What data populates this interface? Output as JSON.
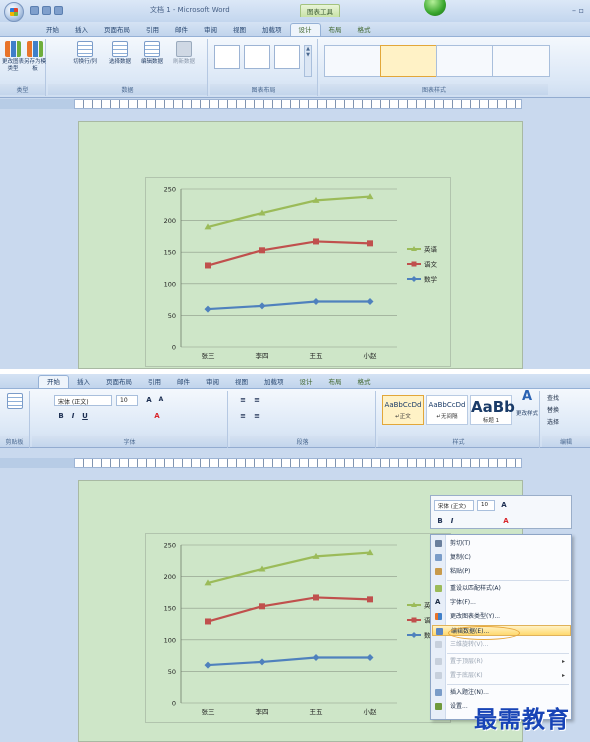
{
  "colors": {
    "english": "#9bbb59",
    "chinese": "#c0504d",
    "math": "#4f81bd",
    "page_bg": "#cee6c8",
    "menu_highlight": "#ffd96e",
    "watermark": "#1844b6"
  },
  "shot1": {
    "window_title": "文档 1 - Microsoft Word",
    "context_tools": "图表工具",
    "tabs": [
      "开始",
      "插入",
      "页面布局",
      "引用",
      "邮件",
      "审阅",
      "视图",
      "加载项",
      "设计",
      "布局",
      "格式"
    ],
    "active_tab": "设计",
    "ribbon": {
      "change_type": "更改图表类型",
      "save_template": "另存为模板",
      "switch_rowcol": "切换行/列",
      "select_data": "选择数据",
      "edit_data": "编辑数据",
      "refresh_data": "刷新数据",
      "group_type": "类型",
      "group_data": "数据",
      "group_layout": "图表布局",
      "group_styles": "图表样式"
    }
  },
  "shot2": {
    "tabs": [
      "开始",
      "插入",
      "页面布局",
      "引用",
      "邮件",
      "审阅",
      "视图",
      "加载项",
      "设计",
      "布局",
      "格式"
    ],
    "font_name": "宋体 (正文)",
    "font_size": "10",
    "groups": [
      "剪贴板",
      "字体",
      "段落",
      "样式",
      "编辑"
    ],
    "styles": [
      {
        "sample": "AaBbCcDd",
        "name": "↵正文"
      },
      {
        "sample": "AaBbCcDd",
        "name": "↵无间隔"
      },
      {
        "sample": "AaBb",
        "name": "标题 1"
      }
    ],
    "change_styles": "更改样式",
    "editing": [
      "查找",
      "替换",
      "选择"
    ],
    "mini_font": "宋体 (正文)",
    "mini_size": "10",
    "menu": [
      {
        "label": "剪切(T)",
        "state": "normal"
      },
      {
        "label": "复制(C)",
        "state": "normal"
      },
      {
        "label": "粘贴(P)",
        "state": "normal"
      },
      {
        "label": "重设以匹配样式(A)",
        "state": "normal"
      },
      {
        "label": "字体(F)...",
        "state": "normal"
      },
      {
        "label": "更改图表类型(Y)...",
        "state": "normal"
      },
      {
        "label": "编辑数据(E)...",
        "state": "highlighted"
      },
      {
        "label": "三维旋转(V)...",
        "state": "disabled"
      },
      {
        "label": "置于顶层(R)",
        "state": "disabled"
      },
      {
        "label": "置于底层(K)",
        "state": "disabled"
      },
      {
        "label": "插入题注(N)...",
        "state": "normal"
      },
      {
        "label": "设置...",
        "state": "normal"
      }
    ]
  },
  "chart_data": {
    "type": "line",
    "categories": [
      "张三",
      "李四",
      "王五",
      "小赵"
    ],
    "series": [
      {
        "name": "英语",
        "values": [
          190,
          212,
          232,
          238
        ],
        "color": "#9bbb59",
        "marker": "triangle"
      },
      {
        "name": "语文",
        "values": [
          129,
          153,
          167,
          164
        ],
        "color": "#c0504d",
        "marker": "square"
      },
      {
        "name": "数学",
        "values": [
          60,
          65,
          72,
          72
        ],
        "color": "#4f81bd",
        "marker": "diamond"
      }
    ],
    "ylim": [
      0,
      250
    ],
    "yticks": [
      0,
      50,
      100,
      150,
      200,
      250
    ],
    "grid": true,
    "legend_position": "right"
  },
  "watermark": "最需教育"
}
